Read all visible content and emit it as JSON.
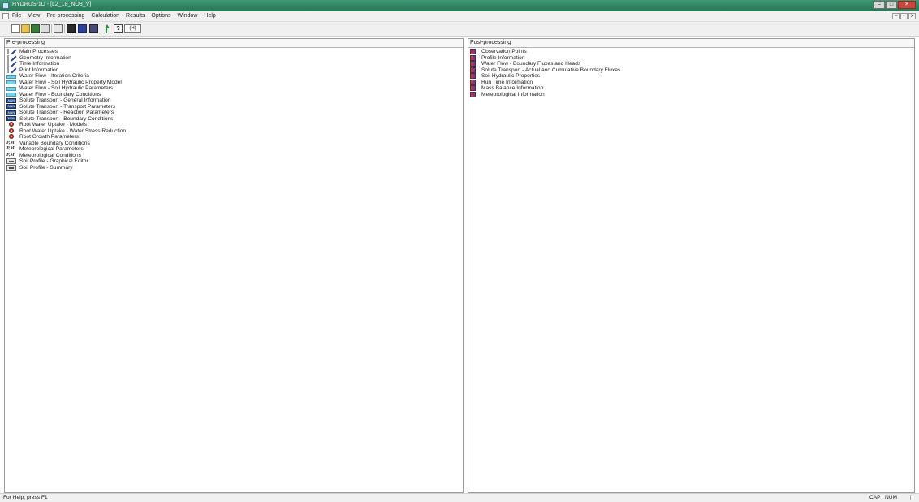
{
  "window": {
    "title": "HYDRUS-1D - [L2_18_NO3_V]",
    "buttons": {
      "minimize": "–",
      "maximize": "□",
      "close": "✕"
    }
  },
  "menu": {
    "items": [
      "File",
      "View",
      "Pre-processing",
      "Calculation",
      "Results",
      "Options",
      "Window",
      "Help"
    ],
    "mdi_buttons": {
      "minimize": "–",
      "restore": "▫",
      "close": "x"
    }
  },
  "toolbar": {
    "help_label": "?",
    "about_label": "(H)",
    "icons": [
      "new-file-icon",
      "open-folder-icon",
      "open-color-icon",
      "save-icon",
      "edit-icon",
      "view-1-icon",
      "view-2-icon",
      "view-3-icon",
      "calculate-arrow-icon",
      "help-pointer-icon",
      "about-icon"
    ]
  },
  "preprocessing": {
    "header": "Pre-processing",
    "items": [
      {
        "label": "Main Processes",
        "icon": "pencil"
      },
      {
        "label": "Geometry Information",
        "icon": "pencil"
      },
      {
        "label": "Time Information",
        "icon": "pencil"
      },
      {
        "label": "Print Information",
        "icon": "pencil"
      },
      {
        "label": "Water Flow - Iteration Criteria",
        "icon": "water"
      },
      {
        "label": "Water Flow - Soil Hydraulic Property Model",
        "icon": "water"
      },
      {
        "label": "Water Flow - Soil Hydraulic Parameters",
        "icon": "water"
      },
      {
        "label": "Water Flow - Boundary Conditions",
        "icon": "water"
      },
      {
        "label": "Solute Transport - General Information",
        "icon": "solute"
      },
      {
        "label": "Solute Transport - Transport Parameters",
        "icon": "solute"
      },
      {
        "label": "Solute Transport - Reaction Parameters",
        "icon": "solute"
      },
      {
        "label": "Solute Transport - Boundary Conditions",
        "icon": "solute"
      },
      {
        "label": "Root Water Uptake - Models",
        "icon": "root"
      },
      {
        "label": "Root Water Uptake - Water Stress Reduction",
        "icon": "root"
      },
      {
        "label": "Root Growth Parameters",
        "icon": "root"
      },
      {
        "label": "Variable Boundary Conditions",
        "icon": "pm"
      },
      {
        "label": "Meteorological Parameters",
        "icon": "pm"
      },
      {
        "label": "Meteorological Conditions",
        "icon": "pm"
      },
      {
        "label": "Soil Profile - Graphical Editor",
        "icon": "soil"
      },
      {
        "label": "Soil Profile - Summary",
        "icon": "soil"
      }
    ]
  },
  "postprocessing": {
    "header": "Post-processing",
    "items": [
      {
        "label": "Observation Points",
        "icon": "result"
      },
      {
        "label": "Profile Information",
        "icon": "result"
      },
      {
        "label": "Water Flow - Boundary Fluxes and Heads",
        "icon": "result"
      },
      {
        "label": "Solute Transport - Actual and Cumulative Boundary Fluxes",
        "icon": "result"
      },
      {
        "label": "Soil Hydraulic Properties",
        "icon": "result"
      },
      {
        "label": "Run Time Information",
        "icon": "result"
      },
      {
        "label": "Mass Balance Information",
        "icon": "result"
      },
      {
        "label": "Meteorological Information",
        "icon": "result"
      }
    ]
  },
  "status": {
    "help_text": "For Help, press F1",
    "cap": "CAP",
    "num": "NUM"
  }
}
